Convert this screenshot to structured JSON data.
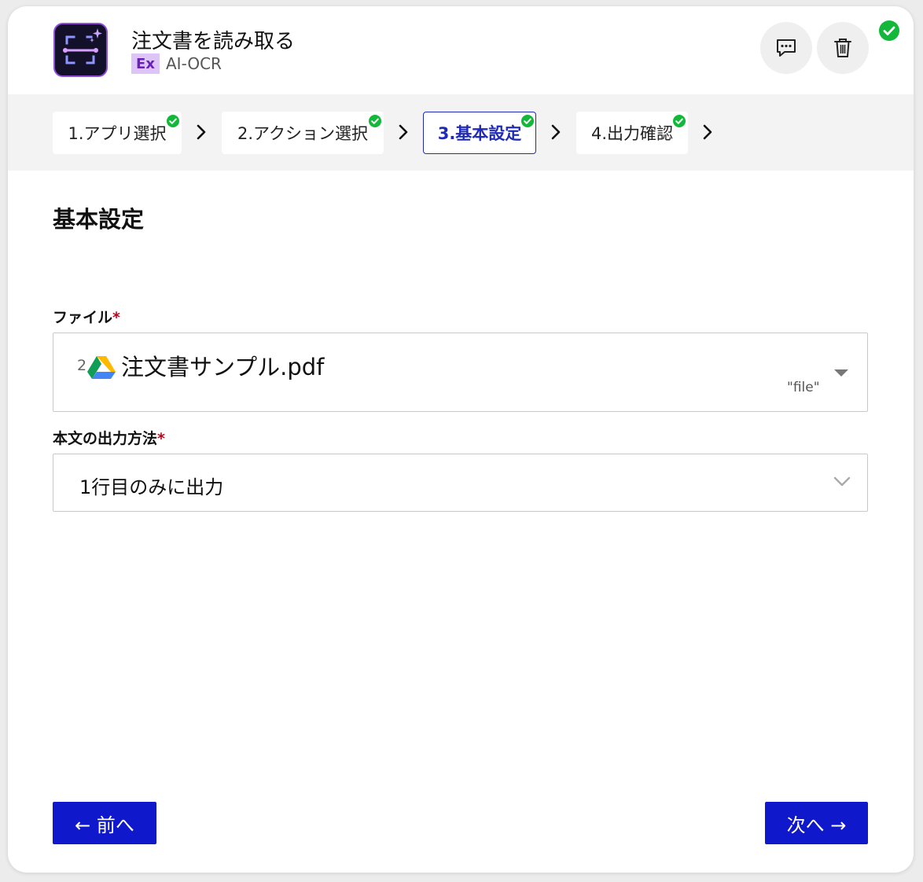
{
  "header": {
    "title": "注文書を読み取る",
    "badge": "Ex",
    "subtitle": "AI-OCR",
    "app_icon": "ai-ocr-scan-icon",
    "comment_icon": "comment-icon",
    "trash_icon": "trash-icon",
    "status": "completed"
  },
  "stepper": {
    "steps": [
      {
        "label": "1.アプリ選択",
        "completed": true,
        "active": false
      },
      {
        "label": "2.アクション選択",
        "completed": true,
        "active": false
      },
      {
        "label": "3.基本設定",
        "completed": true,
        "active": true
      },
      {
        "label": "4.出力確認",
        "completed": true,
        "active": false
      }
    ]
  },
  "main": {
    "section_title": "基本設定",
    "file_field": {
      "label": "ファイル",
      "required_mark": "*",
      "prefix": "2",
      "file_icon": "google-drive-icon",
      "file_name": "注文書サンプル.pdf",
      "variable": "\"file\""
    },
    "output_field": {
      "label": "本文の出力方法",
      "required_mark": "*",
      "selected": "1行目のみに出力"
    }
  },
  "footer": {
    "prev_label": "← 前へ",
    "next_label": "次へ →"
  },
  "colors": {
    "primary": "#1018cc",
    "active_step": "#1f2bb8",
    "success": "#13b83a",
    "required": "#c00018",
    "badge_bg": "#ddc6f7",
    "badge_text": "#6b1fb8"
  }
}
